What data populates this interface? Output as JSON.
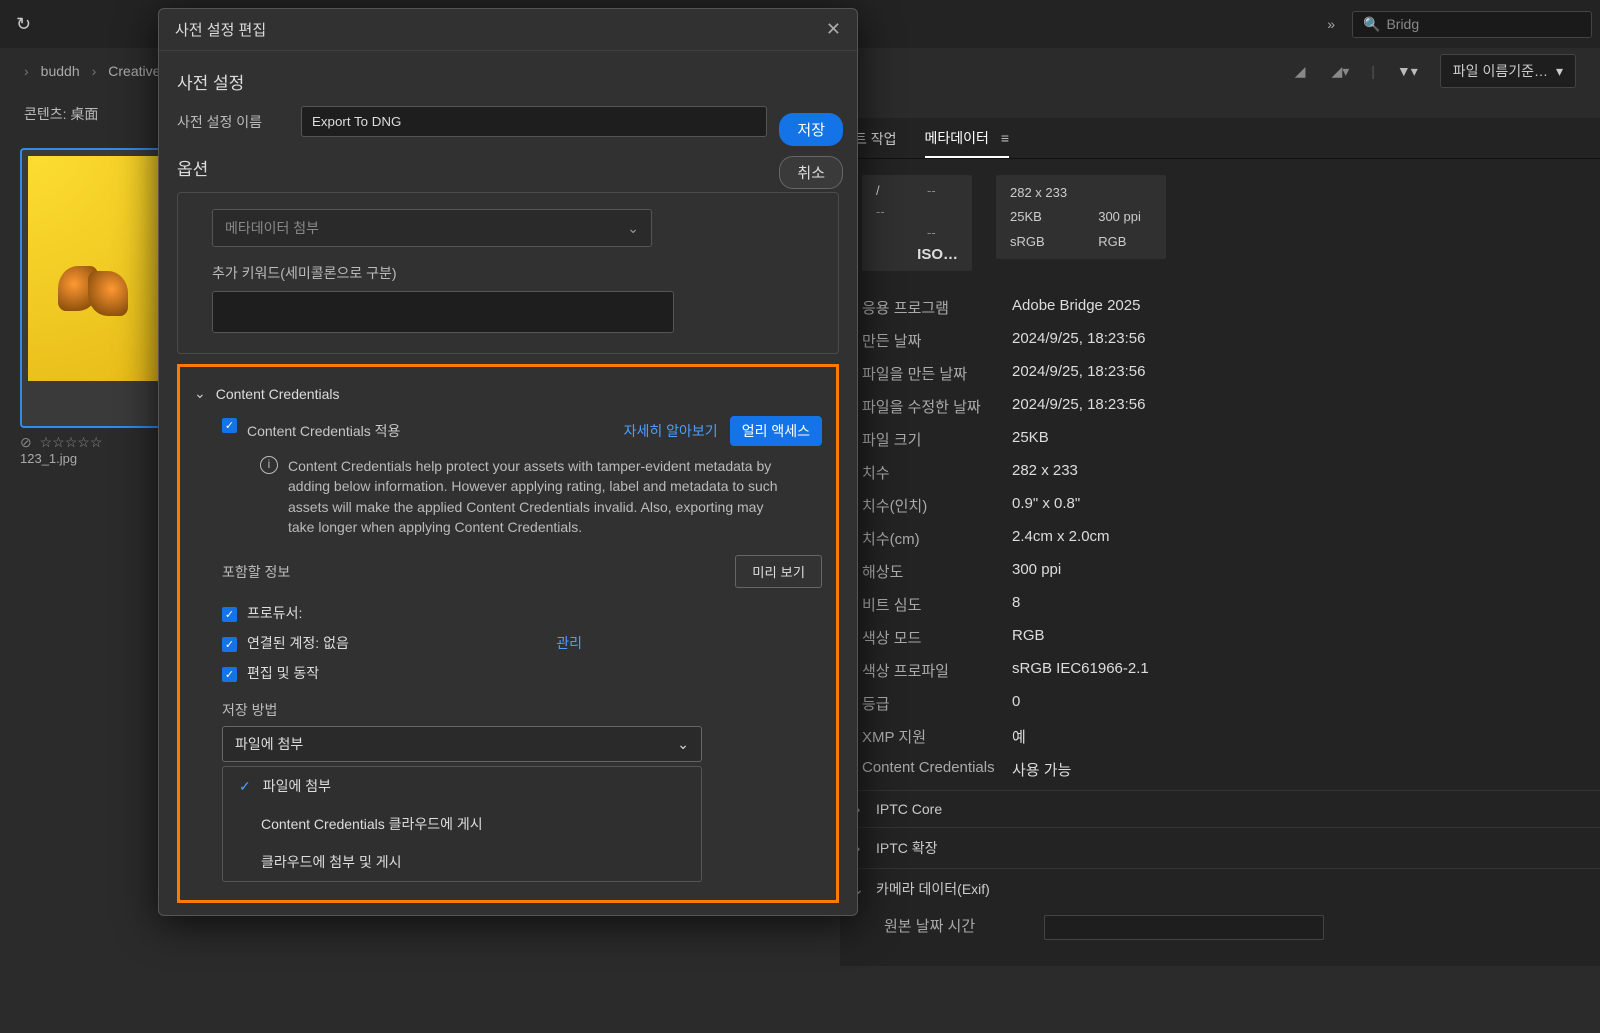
{
  "toolbar": {
    "search_placeholder": "Bridg",
    "more_icon": "»"
  },
  "path": {
    "crumb1": "buddh",
    "crumb2": "Creative",
    "sort_label": "파일 이름기준…"
  },
  "content_label": "콘텐츠: 桌面",
  "thumb": {
    "filename": "123_1.jpg",
    "stars": "☆☆☆☆☆"
  },
  "panel": {
    "tab_tasks": "트 작업",
    "tab_meta": "메타데이터",
    "summary": {
      "dash": "--",
      "iso": "ISO…",
      "dim": "282 x 233",
      "size": "25KB",
      "ppi": "300 ppi",
      "space": "sRGB",
      "mode": "RGB"
    },
    "rows": {
      "app_k": "응용 프로그램",
      "app_v": "Adobe Bridge 2025",
      "created_k": "만든 날짜",
      "created_v": "2024/9/25, 18:23:56",
      "filecreated_k": "파일을 만든 날짜",
      "filecreated_v": "2024/9/25, 18:23:56",
      "modified_k": "파일을 수정한 날짜",
      "modified_v": "2024/9/25, 18:23:56",
      "filesize_k": "파일 크기",
      "filesize_v": "25KB",
      "dim_k": "치수",
      "dim_v": "282 x 233",
      "dimin_k": "치수(인치)",
      "dimin_v": "0.9\" x 0.8\"",
      "dimcm_k": "치수(cm)",
      "dimcm_v": "2.4cm x 2.0cm",
      "res_k": "해상도",
      "res_v": "300 ppi",
      "bit_k": "비트 심도",
      "bit_v": "8",
      "cmode_k": "색상 모드",
      "cmode_v": "RGB",
      "cprof_k": "색상 프로파일",
      "cprof_v": "sRGB IEC61966-2.1",
      "rating_k": "등급",
      "rating_v": "0",
      "xmp_k": "XMP 지원",
      "xmp_v": "예",
      "cc_k": "Content Credentials",
      "cc_v": "사용 가능"
    },
    "sections": {
      "iptc_core": "IPTC Core",
      "iptc_ext": "IPTC 확장",
      "exif": "카메라 데이터(Exif)",
      "orig_time": "원본 날짜 시간"
    }
  },
  "dialog": {
    "title": "사전 설정 편집",
    "heading": "사전 설정",
    "name_label": "사전 설정 이름",
    "name_value": "Export To DNG",
    "save": "저장",
    "cancel": "취소",
    "options_h": "옵션",
    "meta_attach": "메타데이터 첨부",
    "keywords_label": "추가 키워드(세미콜론으로 구분)",
    "cc": {
      "header": "Content Credentials",
      "apply": "Content  Credentials 적용",
      "learn_more": "자세히 알아보기",
      "early_access": "얼리 액세스",
      "desc": "Content Credentials help protect your assets with tamper-evident metadata by adding below information. However applying rating, label and metadata to such assets will make the applied Content Credentials invalid. Also, exporting may take longer when applying Content Credentials.",
      "include_label": "포함할 정보",
      "preview": "미리 보기",
      "producer": "프로듀서:",
      "linked_account": "연결된 계정: 없음",
      "manage": "관리",
      "edit_behavior": "편집 및 동작",
      "save_method_label": "저장 방법",
      "method_selected": "파일에 첨부",
      "opt1": "파일에 첨부",
      "opt2": "Content  Credentials 클라우드에 게시",
      "opt3": "클라우드에 첨부 및 게시"
    }
  }
}
